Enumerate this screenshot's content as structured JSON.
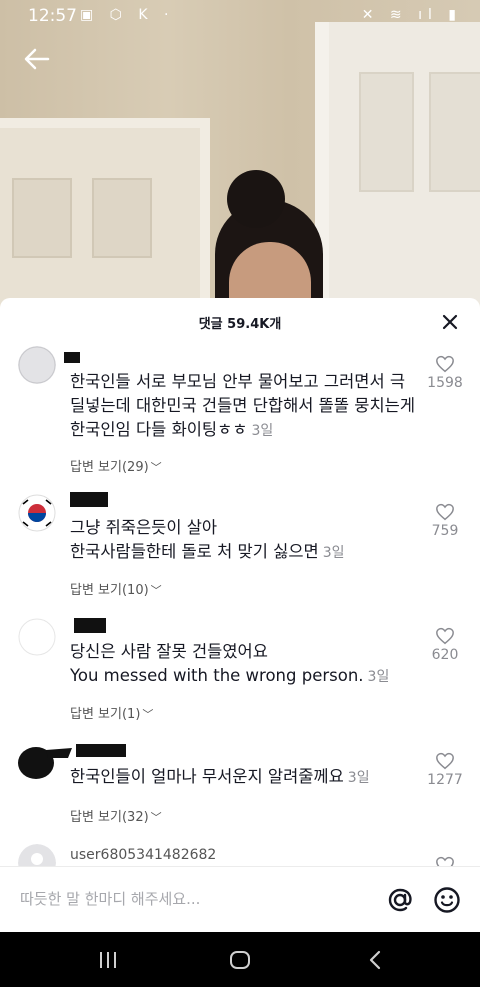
{
  "status_bar": {
    "time": "12:57",
    "left_icons": "▣ ⬡ K ·",
    "right_icons": "✕ ≋ ıl ▮"
  },
  "sheet": {
    "title": "댓글 59.4K개"
  },
  "comments": [
    {
      "username": "",
      "text": "한국인들 서로 부모님 안부 물어보고 그러면서 극딜넣는데 대한민국 건들면 단합해서 똘똘 뭉치는게 한국인임 다들 화이팅ㅎㅎ",
      "time": "3일",
      "replies": "답변 보기(29)",
      "likes": "1598"
    },
    {
      "username": "",
      "text_line1": "그냥 쥐죽은듯이 살아",
      "text_line2": "한국사람들한테 돌로 처 맞기 싫으면",
      "time": "3일",
      "replies": "답변 보기(10)",
      "likes": "759"
    },
    {
      "username": "",
      "text_line1": "당신은 사람 잘못 건들였어요",
      "text_line2": "You messed with the wrong person.",
      "time": "3일",
      "replies": "답변 보기(1)",
      "likes": "620"
    },
    {
      "username": "",
      "text": "한국인들이 얼마나 무서운지 알려줄께요",
      "time": "3일",
      "replies": "답변 보기(32)",
      "likes": "1277"
    },
    {
      "username": "user6805341482682"
    }
  ],
  "input": {
    "placeholder": "따듯한 말 한마디 해주세요..."
  },
  "icons": {
    "back": "arrow-left-icon",
    "close": "close-icon",
    "like": "heart-outline-icon",
    "mention": "at-icon",
    "emoji": "smiley-icon"
  },
  "colors": {
    "text_primary": "#161823",
    "text_secondary": "#8a8b91"
  }
}
